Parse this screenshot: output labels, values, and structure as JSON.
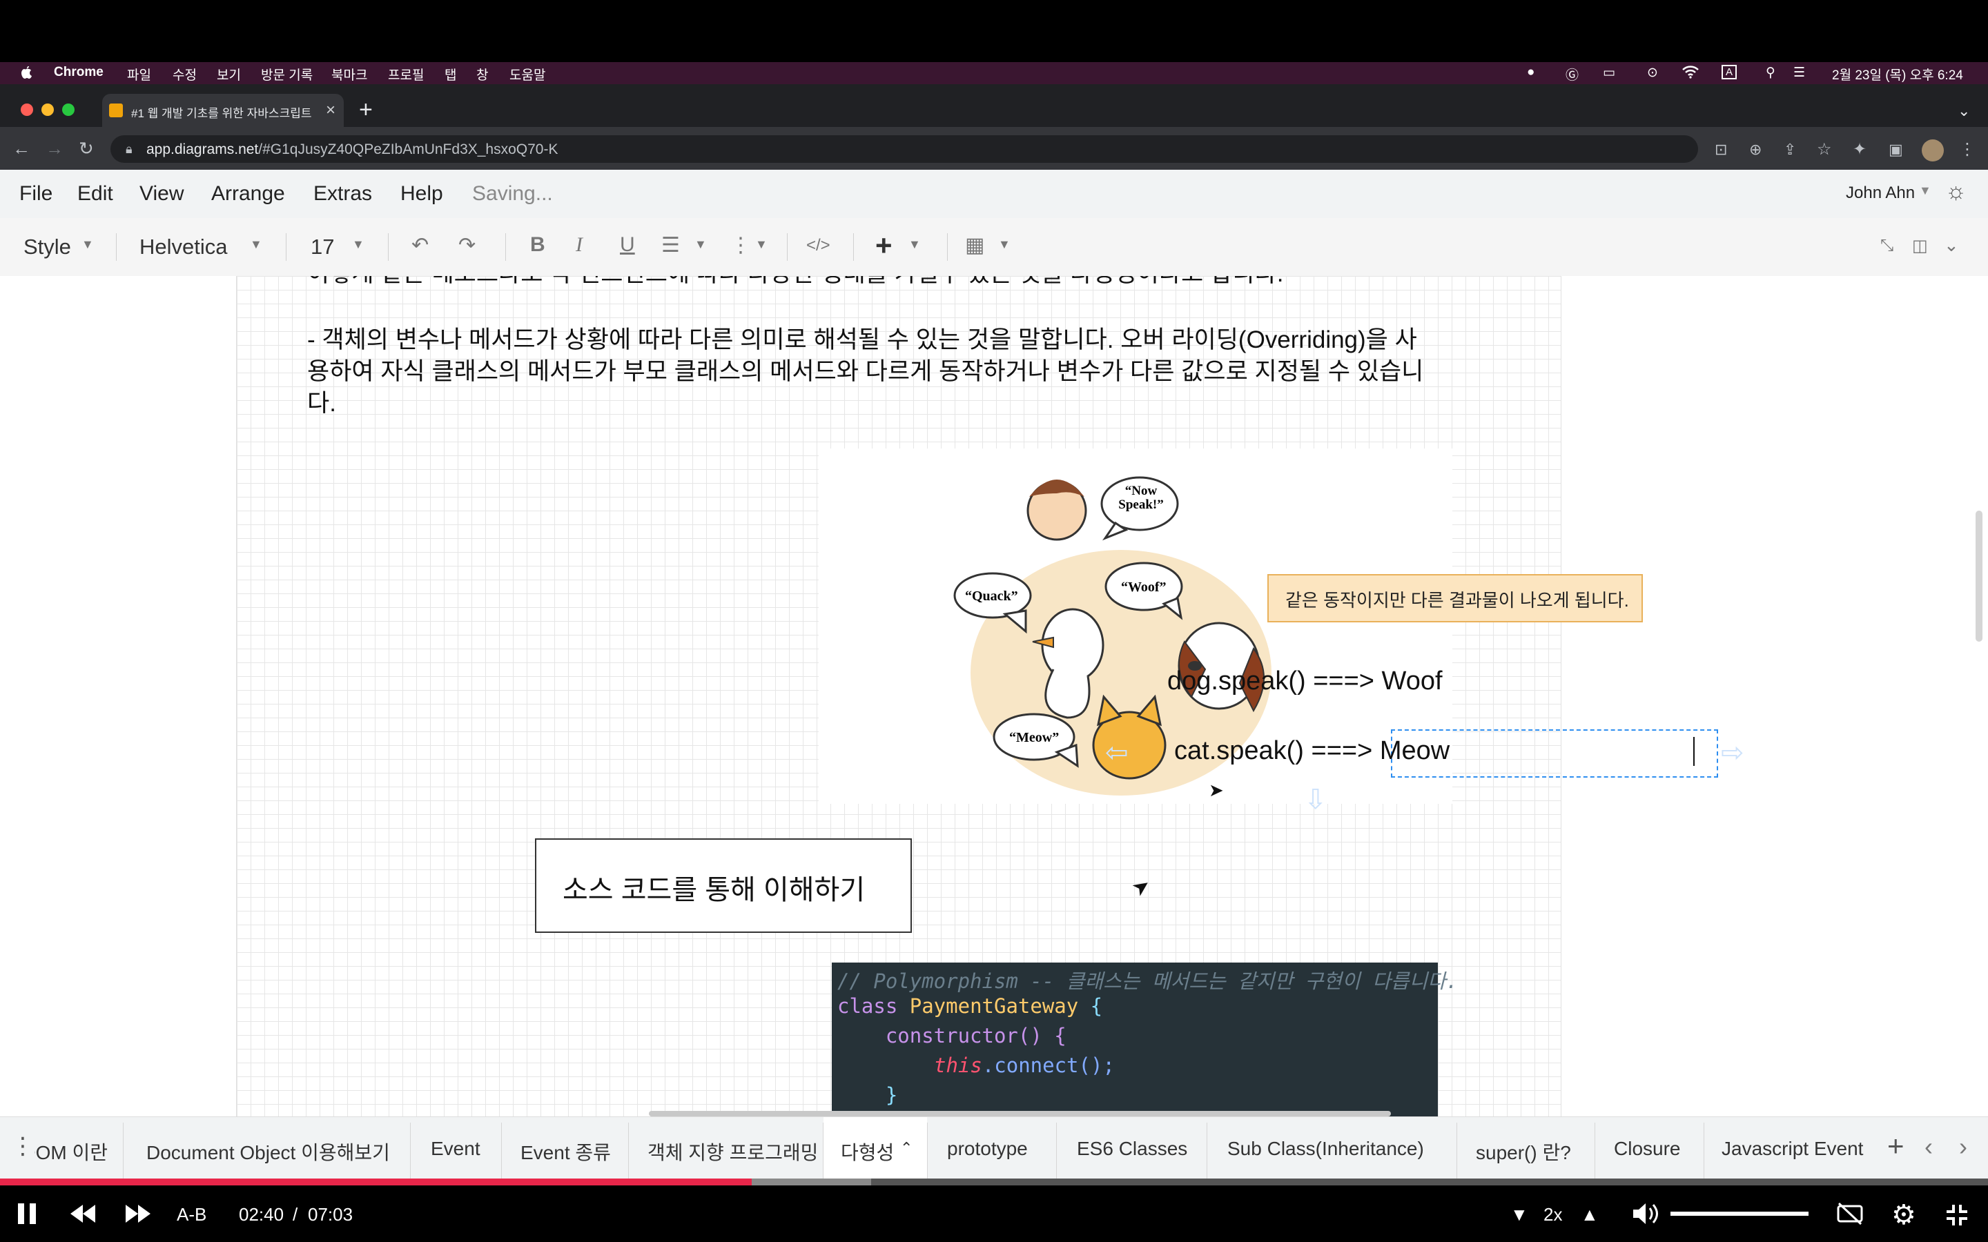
{
  "menubar": {
    "app": "Chrome",
    "items": [
      "파일",
      "수정",
      "보기",
      "방문 기록",
      "북마크",
      "프로필",
      "탭",
      "창",
      "도움말"
    ],
    "datetime": "2월 23일 (목) 오후 6:24",
    "input_indicator": "A"
  },
  "browser": {
    "tab_title": "#1 웹 개발 기초를 위한 자바스크립트",
    "url_host": "app.diagrams.net",
    "url_rest": "/#G1qJusyZ40QPeZIbAmUnFd3X_hsxoQ70-K"
  },
  "drawio": {
    "menu": [
      "File",
      "Edit",
      "View",
      "Arrange",
      "Extras",
      "Help"
    ],
    "status": "Saving...",
    "user": "John Ahn",
    "toolbar": {
      "style_label": "Style",
      "font": "Helvetica",
      "size": "17"
    }
  },
  "canvas": {
    "cut_line": "이렇게 같은 메소드라도 각 인스턴스에 따라 다양한 형태를 가질수 있는 것을 다형성이라고 합니다.",
    "para_lines": [
      "- 객체의 변수나 메서드가 상황에 따라 다른 의미로 해석될 수 있는 것을 말합니다. 오버 라이딩(Overriding)을 사",
      "용하여 자식 클래스의 메서드가 부모 클래스의 메서드와 다르게 동작하거나 변수가 다른 값으로 지정될 수 있습니",
      "다."
    ],
    "bubbles": [
      "“Now Speak!”",
      "“Woof”",
      "“Quack”",
      "“Meow”"
    ],
    "callout": "같은 동작이지만 다른 결과물이 나오게 됩니다.",
    "dog_line": "dog.speak()  ===> Woof",
    "cat_line": "cat.speak()  ===> Meow",
    "source_box": "소스 코드를 통해 이해하기",
    "code": {
      "comment": "// Polymorphism -- 클래스는 메서드는 같지만 구현이 다릅니다.",
      "l2_kw": "class ",
      "l2_name": "PaymentGateway",
      "l2_brace": " {",
      "l3": "    constructor() {",
      "l4_this": "this",
      "l4_rest": ".connect();",
      "l5": "    }"
    }
  },
  "page_tabs": [
    "DOM 이란",
    "Document Object 이용해보기",
    "Event",
    "Event 종류",
    "객체 지향 프로그래밍",
    "다형성",
    "prototype",
    "ES6 Classes",
    "Sub Class(Inheritance)",
    "super() 란?",
    "Closure",
    "Javascript Event"
  ],
  "active_page_tab": "다형성",
  "video": {
    "ab": "A-B",
    "current": "02:40",
    "sep": "/",
    "total": "07:03",
    "speed": "2x",
    "progress": 0.378,
    "buffered": 0.06,
    "volume": 1.0
  },
  "colors": {
    "accent_progress": "#e8264a",
    "callout_fill": "#fce5c0",
    "code_bg": "#263238",
    "selection": "#2e8ef0"
  }
}
